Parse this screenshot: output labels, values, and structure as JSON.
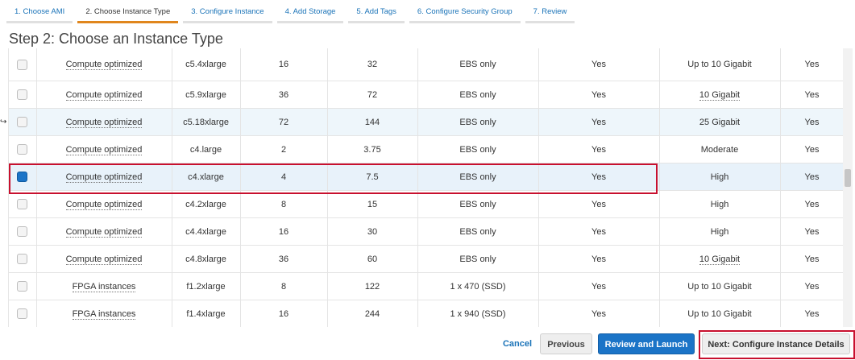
{
  "wizard": {
    "steps": [
      {
        "label": "1. Choose AMI"
      },
      {
        "label": "2. Choose Instance Type"
      },
      {
        "label": "3. Configure Instance"
      },
      {
        "label": "4. Add Storage"
      },
      {
        "label": "5. Add Tags"
      },
      {
        "label": "6. Configure Security Group"
      },
      {
        "label": "7. Review"
      }
    ],
    "active_step_index": 1
  },
  "page": {
    "title": "Step 2: Choose an Instance Type"
  },
  "table": {
    "rows": [
      {
        "checked": false,
        "family": "Compute optimized",
        "type": "c5.4xlarge",
        "vcpus": "16",
        "memory": "32",
        "storage": "EBS only",
        "ebs_optimized": "Yes",
        "network": "Up to 10 Gigabit",
        "network_dotted": false,
        "ipv6": "Yes"
      },
      {
        "checked": false,
        "family": "Compute optimized",
        "type": "c5.9xlarge",
        "vcpus": "36",
        "memory": "72",
        "storage": "EBS only",
        "ebs_optimized": "Yes",
        "network": "10 Gigabit",
        "network_dotted": true,
        "ipv6": "Yes"
      },
      {
        "checked": false,
        "family": "Compute optimized",
        "type": "c5.18xlarge",
        "vcpus": "72",
        "memory": "144",
        "storage": "EBS only",
        "ebs_optimized": "Yes",
        "network": "25 Gigabit",
        "network_dotted": false,
        "ipv6": "Yes"
      },
      {
        "checked": false,
        "family": "Compute optimized",
        "type": "c4.large",
        "vcpus": "2",
        "memory": "3.75",
        "storage": "EBS only",
        "ebs_optimized": "Yes",
        "network": "Moderate",
        "network_dotted": false,
        "ipv6": "Yes"
      },
      {
        "checked": true,
        "family": "Compute optimized",
        "type": "c4.xlarge",
        "vcpus": "4",
        "memory": "7.5",
        "storage": "EBS only",
        "ebs_optimized": "Yes",
        "network": "High",
        "network_dotted": false,
        "ipv6": "Yes"
      },
      {
        "checked": false,
        "family": "Compute optimized",
        "type": "c4.2xlarge",
        "vcpus": "8",
        "memory": "15",
        "storage": "EBS only",
        "ebs_optimized": "Yes",
        "network": "High",
        "network_dotted": false,
        "ipv6": "Yes"
      },
      {
        "checked": false,
        "family": "Compute optimized",
        "type": "c4.4xlarge",
        "vcpus": "16",
        "memory": "30",
        "storage": "EBS only",
        "ebs_optimized": "Yes",
        "network": "High",
        "network_dotted": false,
        "ipv6": "Yes"
      },
      {
        "checked": false,
        "family": "Compute optimized",
        "type": "c4.8xlarge",
        "vcpus": "36",
        "memory": "60",
        "storage": "EBS only",
        "ebs_optimized": "Yes",
        "network": "10 Gigabit",
        "network_dotted": true,
        "ipv6": "Yes"
      },
      {
        "checked": false,
        "family": "FPGA instances",
        "type": "f1.2xlarge",
        "vcpus": "8",
        "memory": "122",
        "storage": "1 x 470 (SSD)",
        "ebs_optimized": "Yes",
        "network": "Up to 10 Gigabit",
        "network_dotted": false,
        "ipv6": "Yes"
      },
      {
        "checked": false,
        "family": "FPGA instances",
        "type": "f1.4xlarge",
        "vcpus": "16",
        "memory": "244",
        "storage": "1 x 940 (SSD)",
        "ebs_optimized": "Yes",
        "network": "Up to 10 Gigabit",
        "network_dotted": false,
        "ipv6": "Yes"
      }
    ],
    "hover_row_index": 2,
    "selected_row_index": 4
  },
  "footer": {
    "cancel_label": "Cancel",
    "previous_label": "Previous",
    "review_launch_label": "Review and Launch",
    "next_label": "Next: Configure Instance Details"
  },
  "colors": {
    "accent_blue": "#1b74c7",
    "highlight_red": "#c8102e",
    "active_step_orange": "#e0861d"
  }
}
